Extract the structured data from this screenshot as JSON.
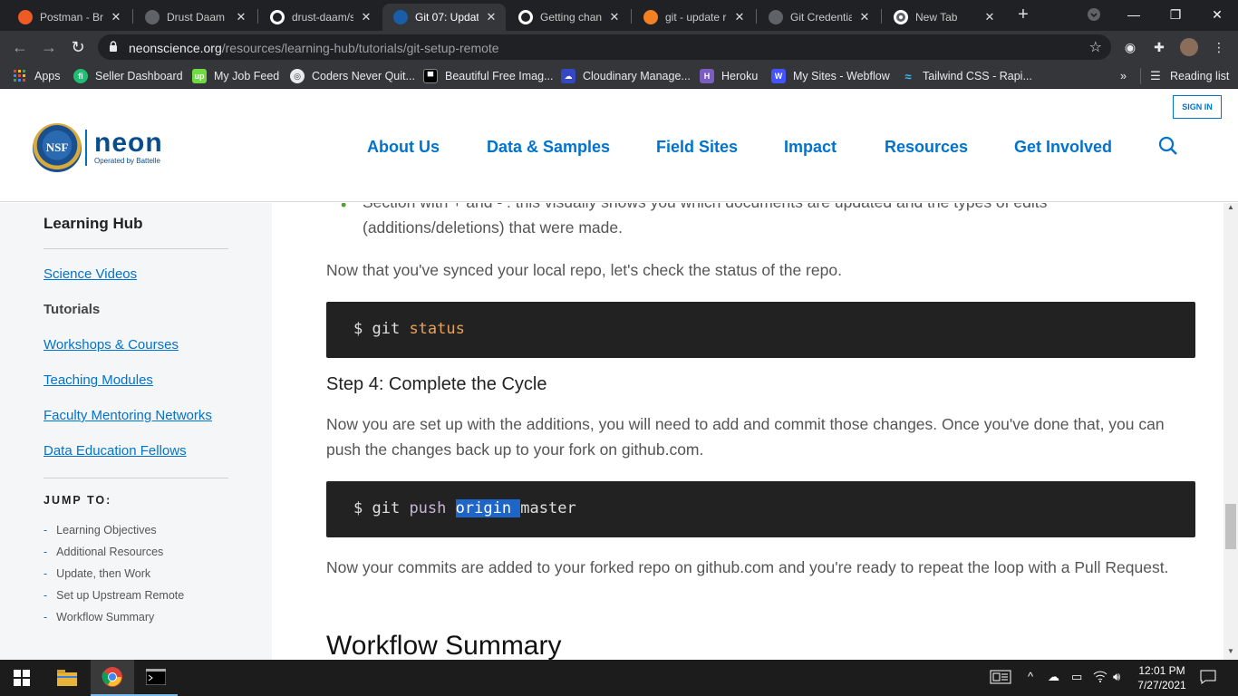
{
  "browser": {
    "tabs": [
      {
        "title": "Postman - Bro",
        "favicon_color": "#ef5b25"
      },
      {
        "title": "Drust Daam",
        "favicon_color": "#5f6368"
      },
      {
        "title": "drust-daam/s",
        "favicon_color": "#ffffff"
      },
      {
        "title": "Git 07: Updat",
        "favicon_color": "#1a5ea8",
        "active": true
      },
      {
        "title": "Getting chang",
        "favicon_color": "#ffffff"
      },
      {
        "title": "git - update r",
        "favicon_color": "#f48024"
      },
      {
        "title": "Git Credential",
        "favicon_color": "#5f6368"
      },
      {
        "title": "New Tab",
        "favicon_color": "#ffffff"
      }
    ],
    "url_host": "neonscience.org",
    "url_path": "/resources/learning-hub/tutorials/git-setup-remote",
    "bookmarks": [
      {
        "label": "Apps",
        "color": "#ea4335"
      },
      {
        "label": "Seller Dashboard",
        "color": "#1dbf73"
      },
      {
        "label": "My Job Feed",
        "color": "#6fda44"
      },
      {
        "label": "Coders Never Quit...",
        "color": "#5f6368"
      },
      {
        "label": "Beautiful Free Imag...",
        "color": "#000000"
      },
      {
        "label": "Cloudinary Manage...",
        "color": "#3448c5"
      },
      {
        "label": "Heroku",
        "color": "#7b5cc1"
      },
      {
        "label": "My Sites - Webflow",
        "color": "#4353ff"
      },
      {
        "label": "Tailwind CSS - Rapi...",
        "color": "#38bdf8"
      }
    ],
    "bookmarks_overflow": "»",
    "reading_list": "Reading list"
  },
  "site": {
    "logo_seal": "NSF",
    "logo_word": "neon",
    "logo_sub": "Operated by Battelle",
    "signin": "SIGN IN",
    "nav": [
      "About Us",
      "Data & Samples",
      "Field Sites",
      "Impact",
      "Resources",
      "Get Involved"
    ]
  },
  "sidebar": {
    "title": "Learning Hub",
    "links": [
      "Science Videos",
      "Tutorials",
      "Workshops & Courses",
      "Teaching Modules",
      "Faculty Mentoring Networks",
      "Data Education Fellows"
    ],
    "current": "Tutorials",
    "jump_title": "JUMP TO:",
    "jump_items": [
      "Learning Objectives",
      "Additional Resources",
      "Update, then Work",
      "Set up Upstream Remote",
      "Workflow Summary"
    ]
  },
  "content": {
    "bullet_text": "Section with + and - : this visually shows you which documents are updated and the types of edits (additions/deletions) that were made.",
    "p1": "Now that you've synced your local repo, let's check the status of the repo.",
    "code1_prompt": "$ git",
    "code1_cmd": "status",
    "step4": "Step 4: Complete the Cycle",
    "p2": "Now you are set up with the additions, you will need to add and commit those changes. Once you've done that, you can push the changes back up to your fork on github.com.",
    "code2_prompt": "$ git",
    "code2_cmd": "push",
    "code2_sel": "origin ",
    "code2_rest": "master",
    "p3": "Now your commits are added to your forked repo on github.com and you're ready to repeat the loop with a Pull Request.",
    "h2": "Workflow Summary"
  },
  "taskbar": {
    "time": "12:01 PM",
    "date": "7/27/2021"
  }
}
